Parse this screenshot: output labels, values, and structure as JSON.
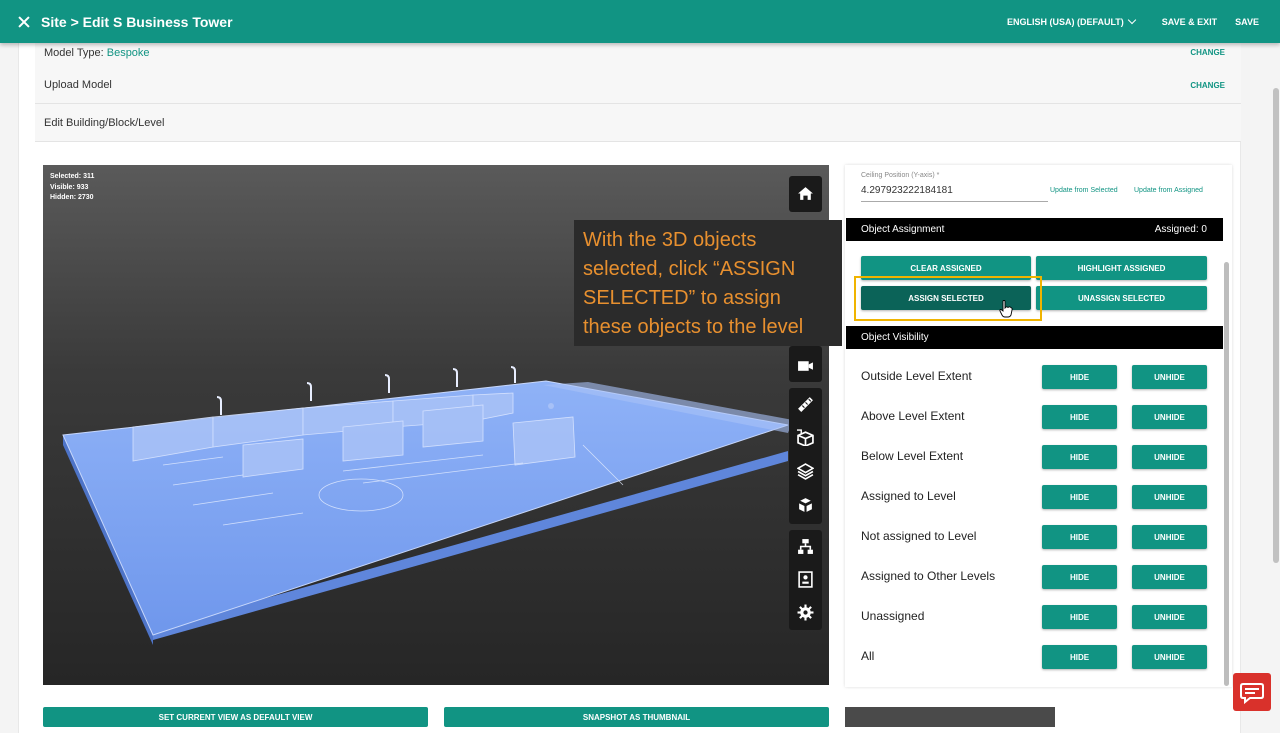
{
  "appbar": {
    "title": "Site > Edit S Business Tower",
    "language": "ENGLISH (USA) (DEFAULT)",
    "save_exit": "SAVE & EXIT",
    "save": "SAVE"
  },
  "rows": {
    "model_type_label": "Model Type:",
    "model_type_value": "Bespoke",
    "upload_model": "Upload Model",
    "edit_building": "Edit Building/Block/Level",
    "change": "CHANGE"
  },
  "viewer": {
    "selected": "Selected: 311",
    "visible": "Visible: 933",
    "hidden": "Hidden: 2730"
  },
  "ceiling": {
    "label": "Ceiling Position (Y-axis) *",
    "value": "4.297923222184181",
    "update_selected": "Update from Selected",
    "update_assigned": "Update from Assigned"
  },
  "object_assignment": {
    "title": "Object Assignment",
    "assigned": "Assigned: 0",
    "clear_assigned": "CLEAR ASSIGNED",
    "highlight_assigned": "HIGHLIGHT ASSIGNED",
    "assign_selected": "ASSIGN SELECTED",
    "unassign_selected": "UNASSIGN SELECTED"
  },
  "object_visibility": {
    "title": "Object Visibility",
    "hide": "HIDE",
    "unhide": "UNHIDE",
    "items": [
      "Outside Level Extent",
      "Above Level Extent",
      "Below Level Extent",
      "Assigned to Level",
      "Not assigned to Level",
      "Assigned to Other Levels",
      "Unassigned",
      "All"
    ]
  },
  "callout": "With the 3D objects selected, click “ASSIGN SELECTED” to assign these objects to the level",
  "bottom": {
    "set_default_view": "SET CURRENT VIEW AS DEFAULT VIEW",
    "snapshot_thumbnail": "SNAPSHOT AS THUMBNAIL"
  },
  "colors": {
    "primary": "#119483",
    "primary_dark": "#0b6358",
    "highlight": "#f0b400",
    "callout_text": "#e8902f",
    "model_blue": "#7fa6f2",
    "chat": "#d9312b"
  },
  "icons": {
    "toolbar": [
      "home-icon",
      "camera-icon",
      "measure-icon",
      "section-box-icon",
      "layers-icon",
      "explode-icon",
      "model-tree-icon",
      "properties-icon",
      "settings-icon"
    ],
    "chat": "chat-icon"
  }
}
